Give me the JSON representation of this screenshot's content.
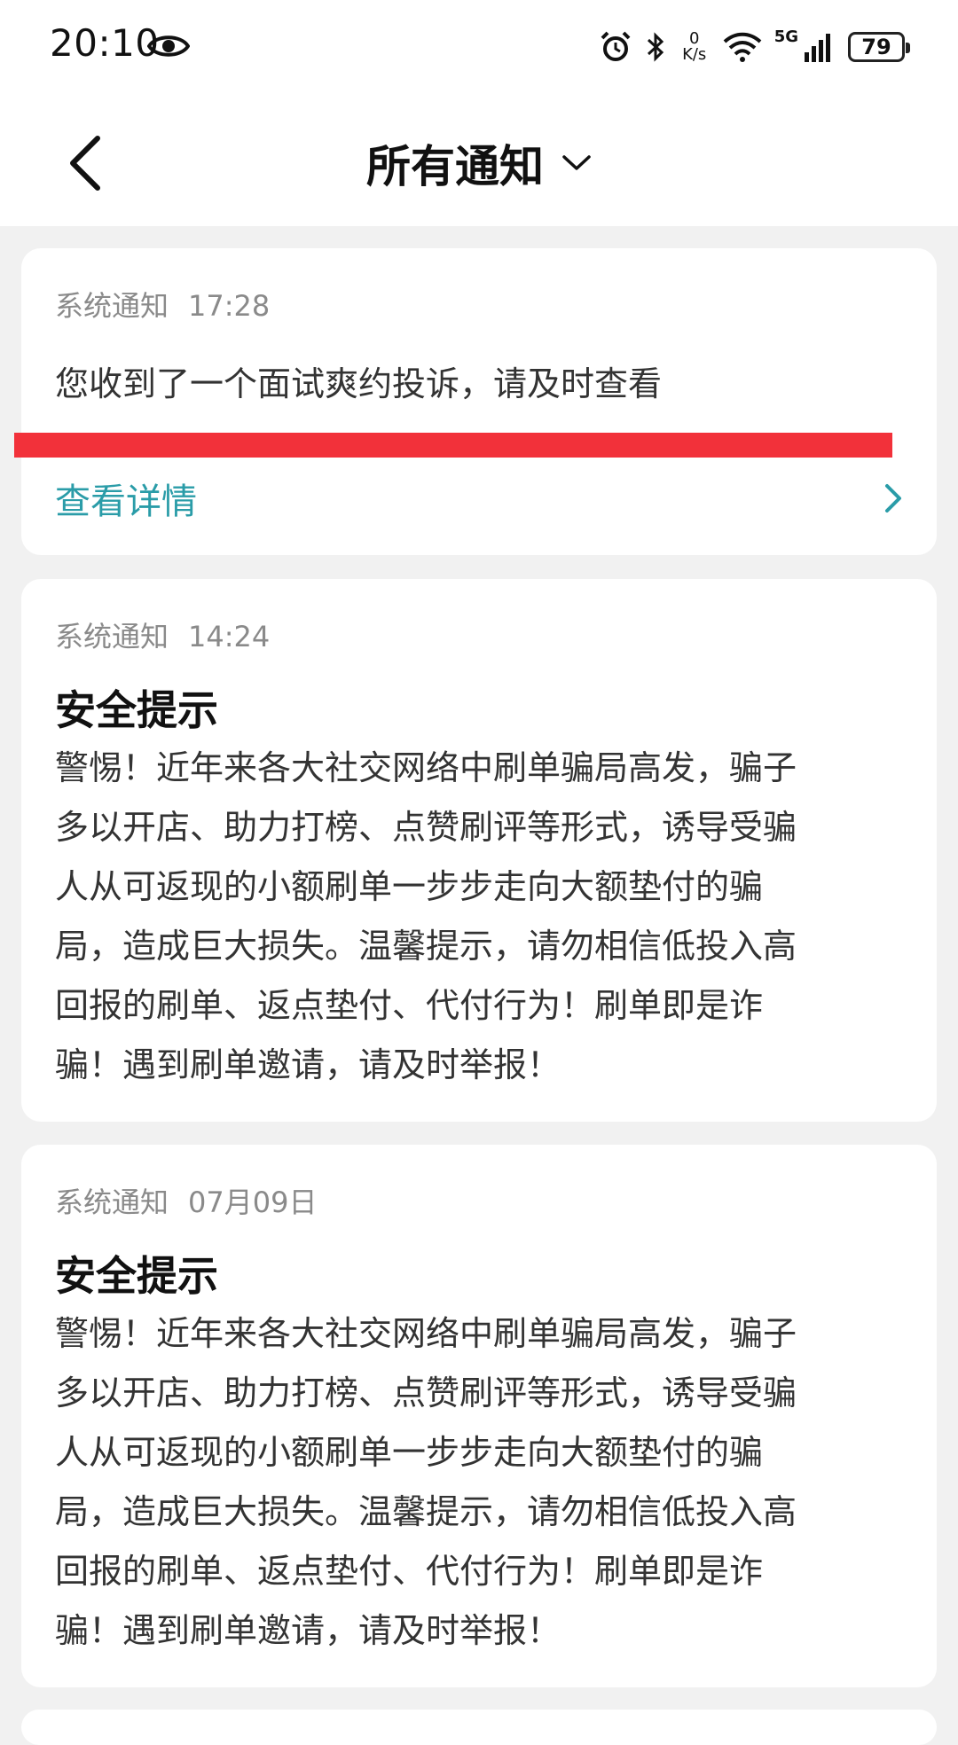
{
  "status_bar": {
    "time": "20:10",
    "net_speed_value": "0",
    "net_speed_unit": "K/s",
    "network": "5G",
    "battery": "79"
  },
  "header": {
    "title": "所有通知"
  },
  "notifications": [
    {
      "category": "系统通知",
      "time": "17:28",
      "body": "您收到了一个面试爽约投诉，请及时查看",
      "link_label": "查看详情"
    },
    {
      "category": "系统通知",
      "time": "14:24",
      "title": "安全提示",
      "lines": [
        "警惕！近年来各大社交网络中刷单骗局高发，骗子",
        "多以开店、助力打榜、点赞刷评等形式，诱导受骗",
        "人从可返现的小额刷单一步步走向大额垫付的骗",
        "局，造成巨大损失。温馨提示，请勿相信低投入高",
        "回报的刷单、返点垫付、代付行为！刷单即是诈",
        "骗！遇到刷单邀请，请及时举报！"
      ]
    },
    {
      "category": "系统通知",
      "time": "07月09日",
      "title": "安全提示",
      "lines": [
        "警惕！近年来各大社交网络中刷单骗局高发，骗子",
        "多以开店、助力打榜、点赞刷评等形式，诱导受骗",
        "人从可返现的小额刷单一步步走向大额垫付的骗",
        "局，造成巨大损失。温馨提示，请勿相信低投入高",
        "回报的刷单、返点垫付、代付行为！刷单即是诈",
        "骗！遇到刷单邀请，请及时举报！"
      ]
    }
  ],
  "colors": {
    "accent": "#2a9ca8",
    "redaction": "#f2313a",
    "background": "#f1f1f1"
  }
}
